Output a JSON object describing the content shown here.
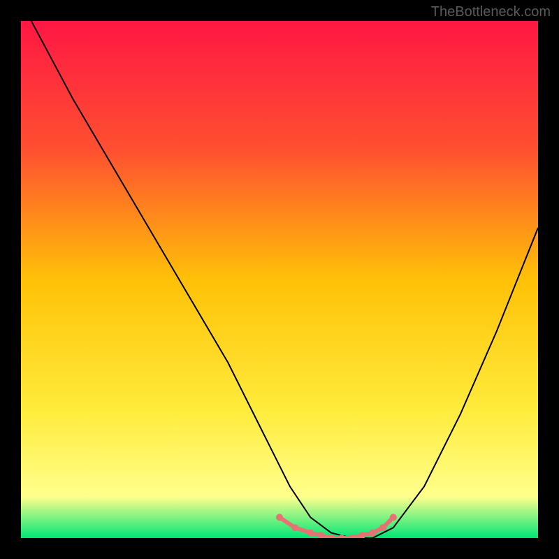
{
  "watermark": "TheBottleneck.com",
  "chart_data": {
    "type": "line",
    "title": "",
    "xlabel": "",
    "ylabel": "",
    "xlim": [
      0,
      100
    ],
    "ylim": [
      0,
      100
    ],
    "gradient_stops": [
      {
        "offset": 0,
        "color": "#ff1744"
      },
      {
        "offset": 0.25,
        "color": "#ff5030"
      },
      {
        "offset": 0.5,
        "color": "#ffc107"
      },
      {
        "offset": 0.75,
        "color": "#ffeb3b"
      },
      {
        "offset": 0.92,
        "color": "#ffff8d"
      },
      {
        "offset": 1,
        "color": "#00e676"
      }
    ],
    "series": [
      {
        "name": "curve",
        "color": "#000000",
        "x": [
          2,
          10,
          20,
          30,
          40,
          47,
          52,
          56,
          60,
          64,
          68,
          72,
          78,
          85,
          92,
          100
        ],
        "y": [
          100,
          85,
          68,
          51,
          34,
          20,
          10,
          4,
          1,
          0,
          0,
          2,
          10,
          24,
          40,
          60
        ]
      }
    ],
    "marker_points": {
      "name": "bottleneck-zone",
      "color": "#e57373",
      "x": [
        50,
        53,
        56,
        58,
        60,
        62,
        64,
        66,
        68,
        70,
        72
      ],
      "y": [
        4,
        2,
        1,
        0.5,
        0,
        0,
        0,
        0.5,
        1,
        2,
        4
      ]
    }
  }
}
